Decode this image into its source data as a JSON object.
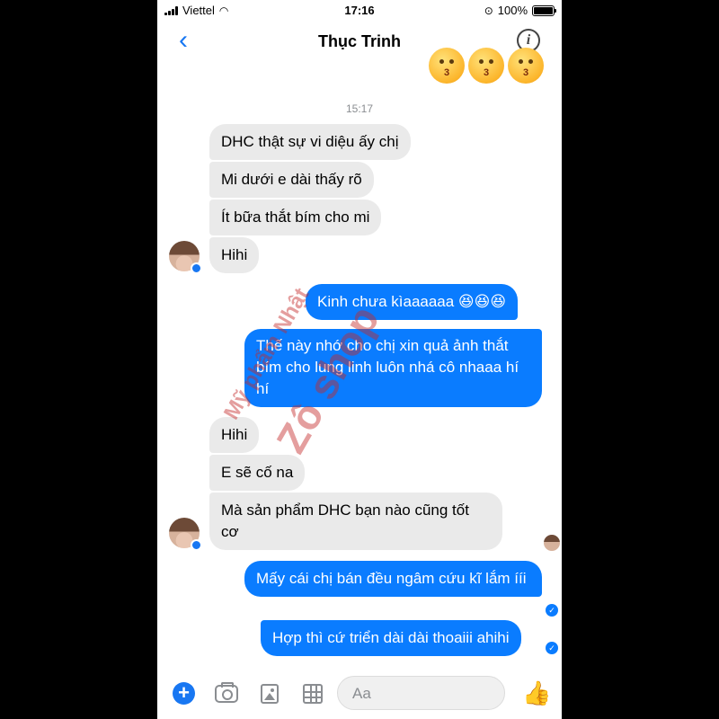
{
  "status_bar": {
    "carrier": "Viettel",
    "time": "17:16",
    "battery": "100%"
  },
  "header": {
    "back_icon": "chevron-left-icon",
    "contact_name": "Thục Trinh",
    "info_icon": "info-icon",
    "info_glyph": "i"
  },
  "conversation": {
    "timestamp": "15:17",
    "messages": [
      {
        "from": "them",
        "text": "DHC thật sự vi diệu ấy chị"
      },
      {
        "from": "them",
        "text": "Mi dưới e dài thấy rõ"
      },
      {
        "from": "them",
        "text": "Ít bữa thắt bím cho mi"
      },
      {
        "from": "them",
        "text": "Hihi"
      },
      {
        "from": "me",
        "text": "Kinh chưa kìaaaaaa 😆😆😆"
      },
      {
        "from": "me",
        "text": "Thế này nhớ cho chị xin quả ảnh thắt bím cho lung linh luôn nhá cô nhaaa hí hí"
      },
      {
        "from": "them",
        "text": "Hihi"
      },
      {
        "from": "them",
        "text": "E sẽ cố na"
      },
      {
        "from": "them",
        "text": "Mà sản phẩm DHC bạn nào cũng tốt cơ"
      },
      {
        "from": "me",
        "text": "Mấy cái chị bán đều ngâm cứu kĩ lắm ííi"
      },
      {
        "from": "me",
        "text": "Hợp thì cứ triển dài dài thoaiii ahihi"
      }
    ]
  },
  "watermark": {
    "line1": "Mỹ phẩm Nhật",
    "line2": "Zô shop"
  },
  "composer": {
    "placeholder": "Aa",
    "plus_label": "+",
    "like_glyph": "👍",
    "delivered_glyph": "✓",
    "icons": [
      "plus-icon",
      "camera-icon",
      "photo-icon",
      "sticker-icon",
      "emoji-icon",
      "like-icon"
    ]
  },
  "colors": {
    "accent": "#1877f2",
    "outgoing_bubble": "#0a7cff",
    "incoming_bubble": "#eaeaea",
    "watermark": "#c42828"
  }
}
